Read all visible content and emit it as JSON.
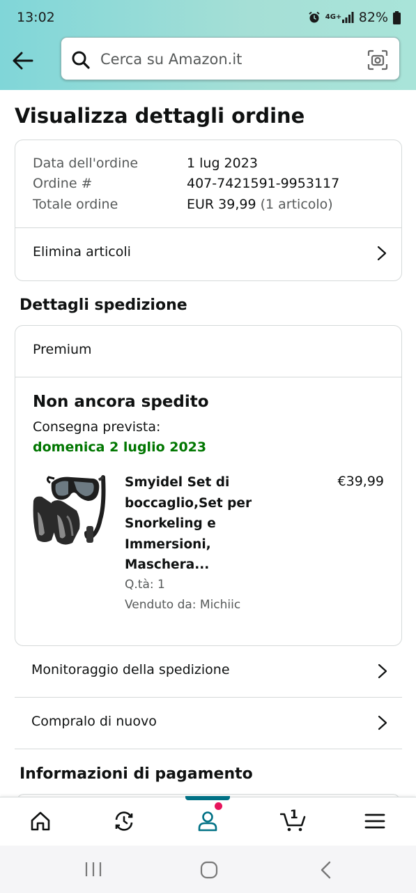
{
  "status_bar": {
    "time": "13:02",
    "network": "4G+",
    "battery": "82%"
  },
  "search": {
    "placeholder": "Cerca su Amazon.it"
  },
  "page_title": "Visualizza dettagli ordine",
  "order_summary": {
    "date_label": "Data dell'ordine",
    "date_value": "1 lug 2023",
    "order_label": "Ordine #",
    "order_value": "407-7421591-9953117",
    "total_label": "Totale ordine",
    "total_value": "EUR 39,99",
    "total_items": "(1 articolo)",
    "delete_items": "Elimina articoli"
  },
  "shipping": {
    "section_title": "Dettagli spedizione",
    "service": "Premium",
    "status": "Non ancora spedito",
    "delivery_label": "Consegna prevista:",
    "delivery_date": "domenica 2 luglio 2023",
    "product": {
      "title_lines": [
        "Smyidel Set di",
        "boccaglio,Set per",
        "Snorkeling e",
        "Immersioni,",
        "Maschera..."
      ],
      "price": "€39,99",
      "qty": "Q.tà: 1",
      "seller": "Venduto da: Michiic"
    }
  },
  "actions": {
    "track": "Monitoraggio della spedizione",
    "buy_again": "Compralo di nuovo"
  },
  "payment": {
    "section_title": "Informazioni di pagamento"
  },
  "bottom_nav": {
    "cart_count": "1"
  },
  "colors": {
    "header_gradient_start": "#80d6d8",
    "header_gradient_end": "#a9e4d9",
    "delivery_green": "#007600",
    "active_teal": "#007185",
    "notification_dot": "#e6155c"
  }
}
